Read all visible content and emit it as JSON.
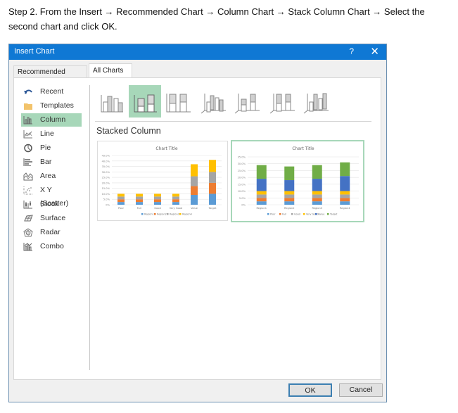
{
  "instruction": {
    "line1": "Step 2. From the Insert → Recommended Chart → Column Chart → Stack Column Chart → Select the",
    "line2": "second chart and click OK."
  },
  "dialog": {
    "title": "Insert Chart",
    "help_label": "?",
    "close_label": "✕",
    "tabs": [
      {
        "label": "Recommended Charts",
        "active": false
      },
      {
        "label": "All Charts",
        "active": true
      }
    ],
    "sidebar": [
      {
        "label": "Recent",
        "icon": "recent-icon",
        "selected": false
      },
      {
        "label": "Templates",
        "icon": "templates-folder-icon",
        "selected": false
      },
      {
        "label": "Column",
        "icon": "column-chart-icon",
        "selected": true
      },
      {
        "label": "Line",
        "icon": "line-chart-icon",
        "selected": false
      },
      {
        "label": "Pie",
        "icon": "pie-chart-icon",
        "selected": false
      },
      {
        "label": "Bar",
        "icon": "bar-chart-icon",
        "selected": false
      },
      {
        "label": "Area",
        "icon": "area-chart-icon",
        "selected": false
      },
      {
        "label": "X Y (Scatter)",
        "icon": "scatter-chart-icon",
        "selected": false
      },
      {
        "label": "Stock",
        "icon": "stock-chart-icon",
        "selected": false
      },
      {
        "label": "Surface",
        "icon": "surface-chart-icon",
        "selected": false
      },
      {
        "label": "Radar",
        "icon": "radar-chart-icon",
        "selected": false
      },
      {
        "label": "Combo",
        "icon": "combo-chart-icon",
        "selected": false
      }
    ],
    "chart_types": [
      {
        "name": "clustered-column",
        "selected": false
      },
      {
        "name": "stacked-column",
        "selected": true
      },
      {
        "name": "100-stacked-column",
        "selected": false
      },
      {
        "name": "3d-clustered-column",
        "selected": false
      },
      {
        "name": "3d-stacked-column",
        "selected": false
      },
      {
        "name": "3d-100-stacked-column",
        "selected": false
      },
      {
        "name": "3d-column",
        "selected": false
      }
    ],
    "subtitle": "Stacked Column",
    "ok_label": "OK",
    "cancel_label": "Cancel"
  },
  "colors": {
    "accent_blue": "#0f78d4",
    "selection_green": "#a7d7b9",
    "series": [
      "#5b9bd5",
      "#ed7d31",
      "#a5a5a5",
      "#ffc000",
      "#4472c4",
      "#70ad47"
    ]
  },
  "chart_data": [
    {
      "type": "bar",
      "stacked": true,
      "title": "Chart Title",
      "categories": [
        "Poor",
        "Fair",
        "Good",
        "Very Good",
        "Value",
        "Target"
      ],
      "series": [
        {
          "name": "Region1",
          "values": [
            2.5,
            2.5,
            2.5,
            2.5,
            9,
            10
          ]
        },
        {
          "name": "Region2",
          "values": [
            2.5,
            2.5,
            2.5,
            2.5,
            8,
            10
          ]
        },
        {
          "name": "Region3",
          "values": [
            2.5,
            2.5,
            2.5,
            2.5,
            9,
            10
          ]
        },
        {
          "name": "Region4",
          "values": [
            2.5,
            2.5,
            2.5,
            2.5,
            11,
            11
          ]
        }
      ],
      "yticks": [
        "0%",
        "5.0%",
        "10.0%",
        "15.0%",
        "20.0%",
        "25.0%",
        "30.0%",
        "35.0%",
        "40.0%",
        "45.0%"
      ],
      "ylim": [
        0,
        45
      ],
      "legend": "bottom",
      "grid": true
    },
    {
      "type": "bar",
      "stacked": true,
      "title": "Chart Title",
      "categories": [
        "Region1",
        "Region2",
        "Region3",
        "Region4"
      ],
      "series": [
        {
          "name": "Poor",
          "values": [
            2.5,
            2.5,
            2.5,
            2.5
          ]
        },
        {
          "name": "Fair",
          "values": [
            2.5,
            2.5,
            2.5,
            2.5
          ]
        },
        {
          "name": "Good",
          "values": [
            2.5,
            2.5,
            2.5,
            2.5
          ]
        },
        {
          "name": "Very Good",
          "values": [
            2.5,
            2.5,
            2.5,
            2.5
          ]
        },
        {
          "name": "Value",
          "values": [
            9,
            8,
            9,
            11
          ]
        },
        {
          "name": "Target",
          "values": [
            10,
            10,
            10,
            10
          ]
        }
      ],
      "yticks": [
        "0%",
        "5.0%",
        "10.0%",
        "15.0%",
        "20.0%",
        "25.0%",
        "30.0%",
        "35.0%"
      ],
      "ylim": [
        0,
        35
      ],
      "legend": "bottom",
      "grid": true
    }
  ]
}
